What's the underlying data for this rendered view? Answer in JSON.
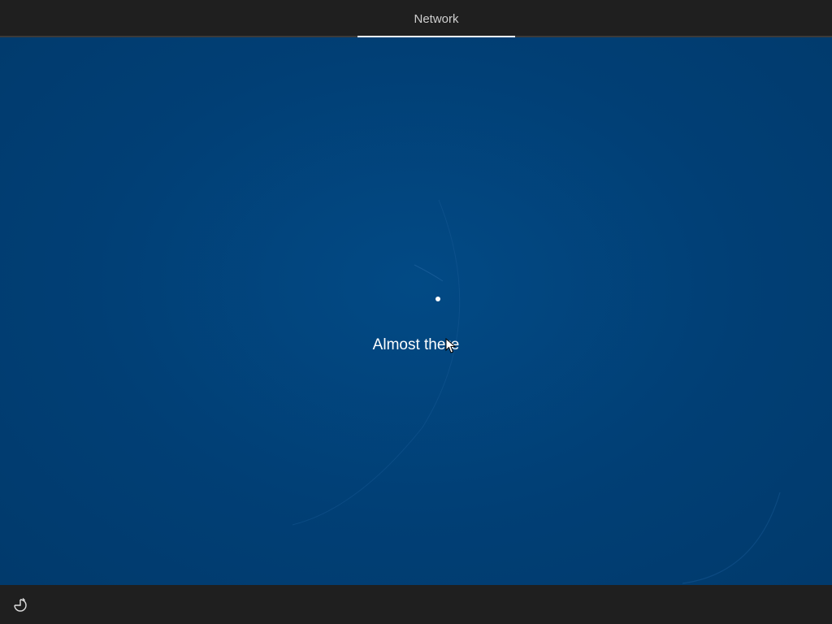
{
  "header": {
    "active_tab_label": "Network"
  },
  "main": {
    "status_text": "Almost there"
  },
  "footer": {
    "ease_of_access_icon": "ease-of-access-icon"
  },
  "colors": {
    "background_blue": "#013f75",
    "bar_background": "#1f1f1f",
    "text": "#ffffff"
  }
}
